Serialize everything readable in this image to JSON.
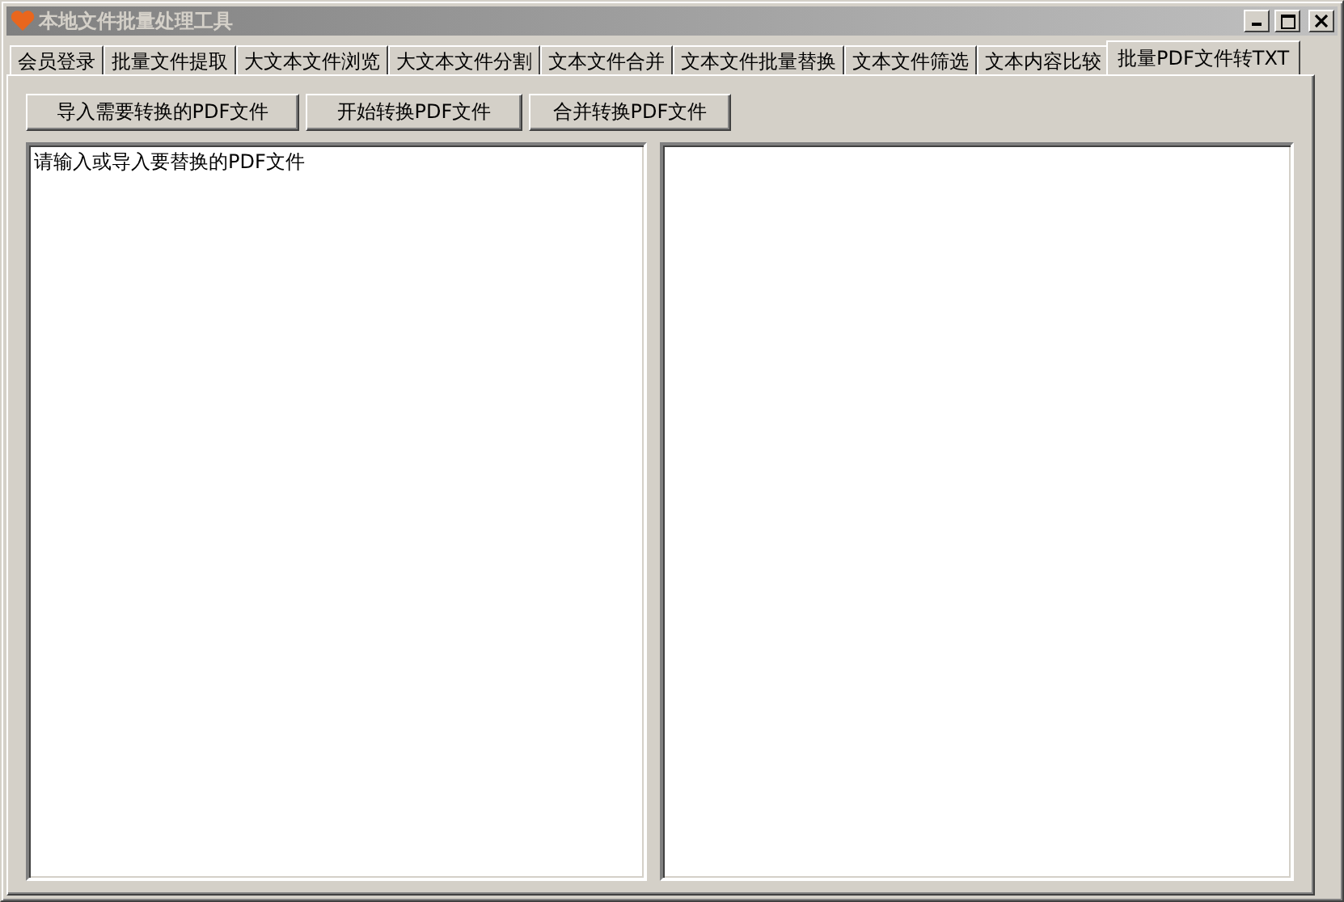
{
  "window": {
    "title": "本地文件批量处理工具",
    "active": false
  },
  "tabs": [
    {
      "label": "会员登录",
      "selected": false
    },
    {
      "label": "批量文件提取",
      "selected": false
    },
    {
      "label": "大文本文件浏览",
      "selected": false
    },
    {
      "label": "大文本文件分割",
      "selected": false
    },
    {
      "label": "文本文件合并",
      "selected": false
    },
    {
      "label": "文本文件批量替换",
      "selected": false
    },
    {
      "label": "文本文件筛选",
      "selected": false
    },
    {
      "label": "文本内容比较",
      "selected": false
    },
    {
      "label": "批量PDF文件转TXT",
      "selected": true
    }
  ],
  "buttons": [
    "导入需要转换的PDF文件",
    "开始转换PDF文件",
    "合并转换PDF文件"
  ],
  "input_area": {
    "value": "请输入或导入要替换的PDF文件"
  }
}
